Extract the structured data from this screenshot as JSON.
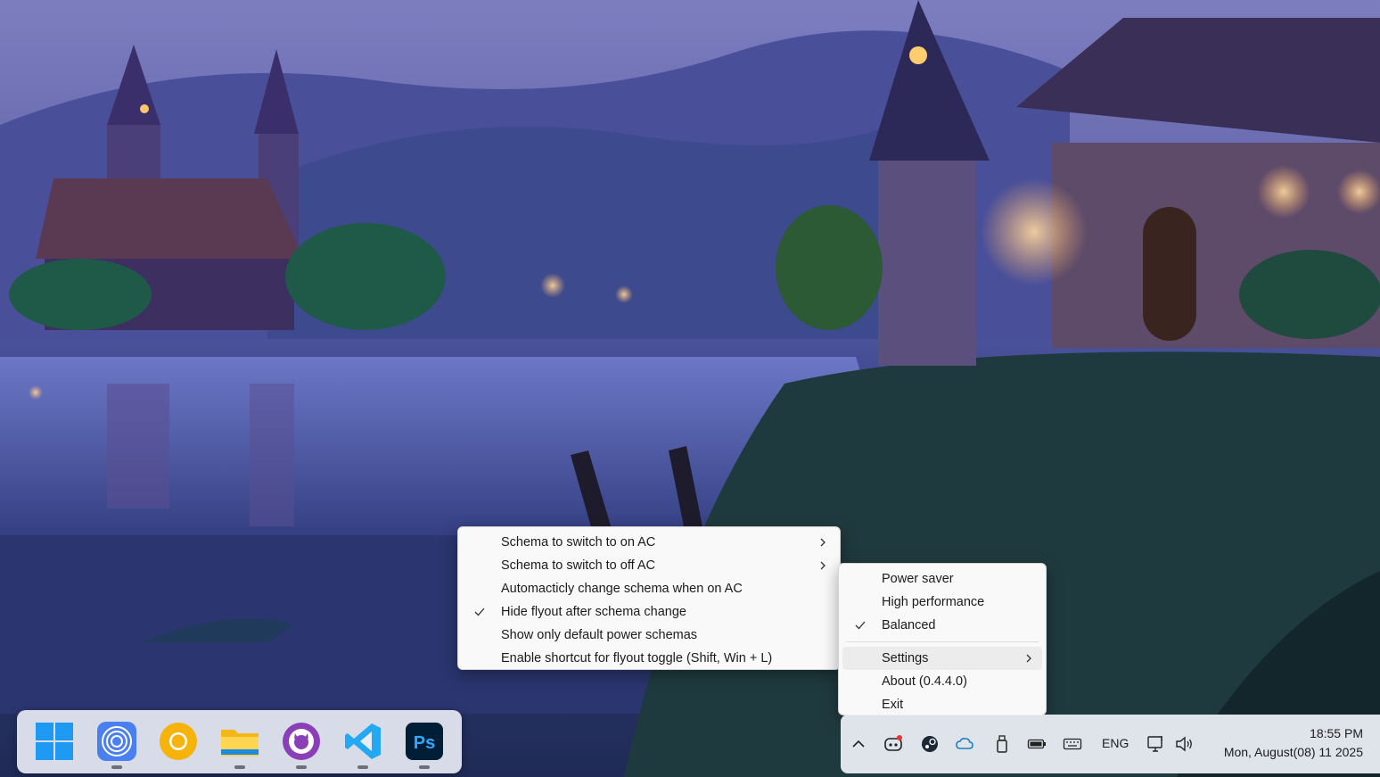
{
  "settings_menu": {
    "items": [
      {
        "label": "Schema to switch to on AC",
        "checked": false,
        "submenu": true
      },
      {
        "label": "Schema to switch to off AC",
        "checked": false,
        "submenu": true
      },
      {
        "label": "Automacticly change schema when on AC",
        "checked": false,
        "submenu": false
      },
      {
        "label": "Hide flyout after schema change",
        "checked": true,
        "submenu": false
      },
      {
        "label": "Show only default power schemas",
        "checked": false,
        "submenu": false
      },
      {
        "label": "Enable shortcut for flyout toggle (Shift, Win + L)",
        "checked": false,
        "submenu": false
      }
    ]
  },
  "tray_menu": {
    "power_schemas": [
      {
        "label": "Power saver",
        "checked": false
      },
      {
        "label": "High performance",
        "checked": false
      },
      {
        "label": "Balanced",
        "checked": true
      }
    ],
    "settings_label": "Settings",
    "about_label": "About (0.4.4.0)",
    "exit_label": "Exit"
  },
  "taskbar": {
    "apps": [
      {
        "name": "start-button",
        "icon": "windows-logo"
      },
      {
        "name": "app-circles",
        "icon": "concentric-circles-icon"
      },
      {
        "name": "chrome-canary",
        "icon": "chrome-icon"
      },
      {
        "name": "file-explorer",
        "icon": "folder-icon"
      },
      {
        "name": "github-desktop",
        "icon": "github-icon"
      },
      {
        "name": "vscode",
        "icon": "vscode-icon"
      },
      {
        "name": "photoshop",
        "icon": "photoshop-icon",
        "text": "Ps"
      }
    ],
    "language": "ENG",
    "time": "18:55 PM",
    "date": "Mon, August(08) 11 2025"
  },
  "colors": {
    "menu_bg": "#f9f9f9",
    "taskbar_bg": "#e8ecf5",
    "vscode_blue": "#23a8f2",
    "photoshop_bg": "#001e36",
    "photoshop_text": "#31a8ff"
  }
}
